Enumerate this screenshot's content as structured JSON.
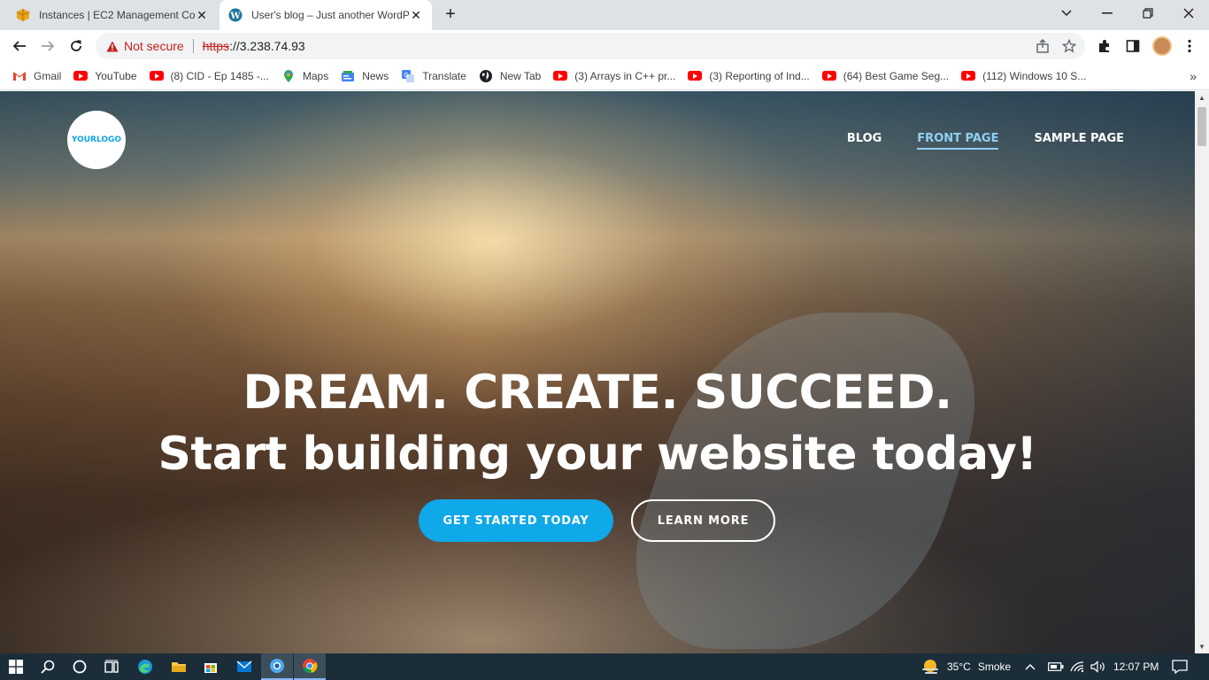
{
  "browser": {
    "tabs": [
      {
        "title": "Instances | EC2 Management Con",
        "active": false,
        "icon": "aws-box-icon"
      },
      {
        "title": "User's blog – Just another WordP",
        "active": true,
        "icon": "wordpress-icon"
      }
    ],
    "address": {
      "security_label": "Not secure",
      "protocol": "https",
      "host": "://3.238.74.93"
    },
    "bookmarks": [
      {
        "label": "Gmail",
        "icon": "gmail-icon"
      },
      {
        "label": "YouTube",
        "icon": "youtube-icon"
      },
      {
        "label": "(8) CID - Ep 1485 -...",
        "icon": "youtube-icon"
      },
      {
        "label": "Maps",
        "icon": "maps-icon"
      },
      {
        "label": "News",
        "icon": "news-icon"
      },
      {
        "label": "Translate",
        "icon": "translate-icon"
      },
      {
        "label": "New Tab",
        "icon": "globe-icon"
      },
      {
        "label": "(3) Arrays in C++ pr...",
        "icon": "youtube-icon"
      },
      {
        "label": "(3) Reporting of Ind...",
        "icon": "youtube-icon"
      },
      {
        "label": "(64) Best Game Seg...",
        "icon": "youtube-icon"
      },
      {
        "label": "(112) Windows 10 S...",
        "icon": "youtube-icon"
      }
    ]
  },
  "site": {
    "logo_text": "YOURLOGO",
    "nav": [
      {
        "label": "BLOG",
        "current": false
      },
      {
        "label": "FRONT PAGE",
        "current": true
      },
      {
        "label": "SAMPLE PAGE",
        "current": false
      }
    ],
    "hero": {
      "headline": "DREAM. CREATE. SUCCEED.",
      "subheadline": "Start building your website today!",
      "primary_cta": "GET STARTED TODAY",
      "secondary_cta": "LEARN MORE"
    }
  },
  "taskbar": {
    "weather_temp": "35°C",
    "weather_desc": "Smoke",
    "time": "12:07 PM"
  },
  "colors": {
    "accent": "#0fa8e8",
    "nav_current": "#8fd0f2",
    "insecure": "#c5221f"
  }
}
